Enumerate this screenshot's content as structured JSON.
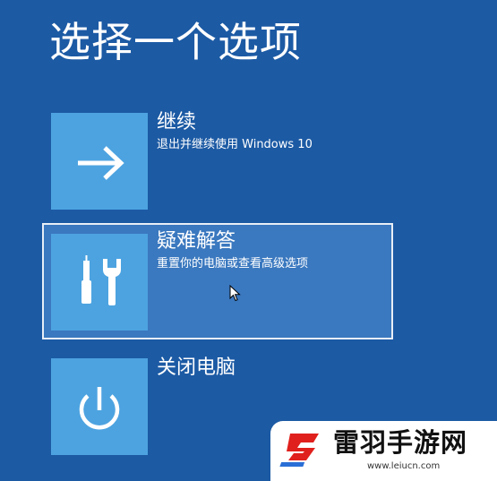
{
  "page": {
    "title": "选择一个选项"
  },
  "options": [
    {
      "title": "继续",
      "description": "退出并继续使用 Windows 10",
      "icon": "arrow-right-icon"
    },
    {
      "title": "疑难解答",
      "description": "重置你的电脑或查看高级选项",
      "icon": "tools-icon",
      "selected": true
    },
    {
      "title": "关闭电脑",
      "description": "",
      "icon": "power-icon"
    }
  ],
  "watermark": {
    "name": "雷羽手游网",
    "url": "www.leiucn.com"
  },
  "colors": {
    "background": "#1c5aa4",
    "tile": "#4da3e0",
    "selected_bg": "#3a78bf",
    "watermark_red": "#e0201c",
    "watermark_blue": "#2a6fd6"
  }
}
